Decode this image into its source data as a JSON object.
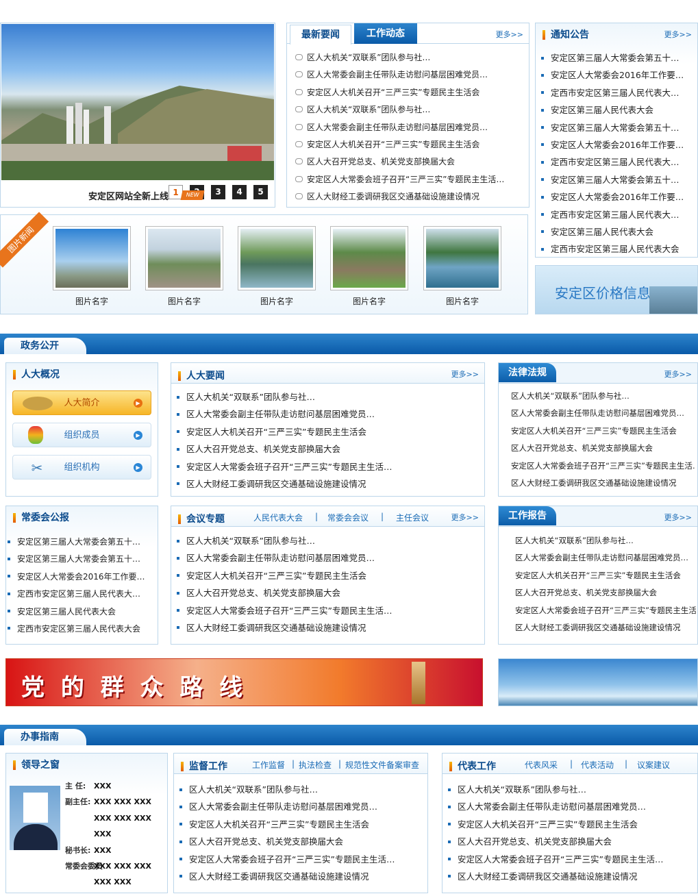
{
  "slider": {
    "caption": "安定区网站全新上线",
    "badge": "NEW",
    "pages": [
      "1",
      "2",
      "3",
      "4",
      "5"
    ]
  },
  "news": {
    "tab1": "最新要闻",
    "tab2": "工作动态",
    "more": "更多>>",
    "items": [
      "区人大机关“双联系”团队参与社…",
      "区人大常委会副主任带队走访慰问基层困难党员…",
      "安定区人大机关召开“三严三实”专题民主生活会",
      "区人大机关“双联系”团队参与社…",
      "区人大常委会副主任带队走访慰问基层困难党员…",
      "安定区人大机关召开“三严三实”专题民主生活会",
      "区人大召开党总支、机关党支部换届大会",
      "安定区人大常委会班子召开“三严三实”专题民主生活…",
      "区人大财经工委调研我区交通基础设施建设情况"
    ]
  },
  "notice": {
    "title": "通知公告",
    "more": "更多>>",
    "items": [
      "安定区第三届人大常委会第五十…",
      "安定区人大常委会2016年工作要…",
      "定西市安定区第三届人民代表大…",
      "安定区第三届人民代表大会",
      "安定区第三届人大常委会第五十…",
      "安定区人大常委会2016年工作要…",
      "定西市安定区第三届人民代表大…",
      "安定区第三届人大常委会第五十…",
      "安定区人大常委会2016年工作要…",
      "定西市安定区第三届人民代表大…",
      "安定区第三届人民代表大会",
      "定西市安定区第三届人民代表大会"
    ]
  },
  "photo": {
    "ribbon": "图片新闻",
    "captions": [
      "图片名字",
      "图片名字",
      "图片名字",
      "图片名字",
      "图片名字"
    ]
  },
  "price_banner": "安定区价格信息网",
  "sec1": {
    "title": "政务公开"
  },
  "overview": {
    "title": "人大概况",
    "buttons": [
      "人大简介",
      "组织成员",
      "组织机构"
    ]
  },
  "bulletin": {
    "title": "常委会公报",
    "items": [
      "安定区第三届人大常委会第五十…",
      "安定区第三届人大常委会第五十…",
      "安定区人大常委会2016年工作要…",
      "定西市安定区第三届人民代表大…",
      "安定区第三届人民代表大会",
      "定西市安定区第三届人民代表大会"
    ]
  },
  "npc_news": {
    "title": "人大要闻",
    "more": "更多>>",
    "items": [
      "区人大机关“双联系”团队参与社…",
      "区人大常委会副主任带队走访慰问基层困难党员…",
      "安定区人大机关召开“三严三实”专题民主生活会",
      "区人大召开党总支、机关党支部换届大会",
      "安定区人大常委会班子召开“三严三实”专题民主生活…",
      "区人大财经工委调研我区交通基础设施建设情况"
    ]
  },
  "meeting": {
    "title": "会议专题",
    "subs": [
      "人民代表大会",
      "常委会会议",
      "主任会议"
    ],
    "more": "更多>>",
    "items": [
      "区人大机关“双联系”团队参与社…",
      "区人大常委会副主任带队走访慰问基层困难党员…",
      "安定区人大机关召开“三严三实”专题民主生活会",
      "区人大召开党总支、机关党支部换届大会",
      "安定区人大常委会班子召开“三严三实”专题民主生活…",
      "区人大财经工委调研我区交通基础设施建设情况"
    ]
  },
  "law": {
    "title": "法律法规",
    "more": "更多>>",
    "items": [
      "区人大机关“双联系”团队参与社…",
      "区人大常委会副主任带队走访慰问基层困难党员…",
      "安定区人大机关召开“三严三实”专题民主生活会",
      "区人大召开党总支、机关党支部换届大会",
      "安定区人大常委会班子召开“三严三实”专题民主生活…",
      "区人大财经工委调研我区交通基础设施建设情况"
    ]
  },
  "report": {
    "title": "工作报告",
    "more": "更多>>",
    "items": [
      "区人大机关“双联系”团队参与社…",
      "区人大常委会副主任带队走访慰问基层困难党员…",
      "安定区人大机关召开“三严三实”专题民主生活会",
      "区人大召开党总支、机关党支部换届大会",
      "安定区人大常委会班子召开“三严三实”专题民主生活…",
      "区人大财经工委调研我区交通基础设施建设情况"
    ]
  },
  "banner_party": "党 的 群 众 路 线",
  "sec2": {
    "title": "办事指南"
  },
  "leader": {
    "title": "领导之窗",
    "rows": [
      {
        "label": "主  任:",
        "names": "XXX"
      },
      {
        "label": "副主任:",
        "names": "XXX XXX XXX"
      },
      {
        "label": "",
        "names": "XXX XXX XXX"
      },
      {
        "label": "",
        "names": "XXX"
      },
      {
        "label": "秘书长:",
        "names": "XXX"
      },
      {
        "label": "常委会委员",
        "names": "XXX XXX XXX"
      },
      {
        "label": "",
        "names": "XXX XXX"
      }
    ]
  },
  "supervise": {
    "title": "监督工作",
    "subs": [
      "工作监督",
      "执法检查",
      "规范性文件备案审查"
    ],
    "items": [
      "区人大机关“双联系”团队参与社…",
      "区人大常委会副主任带队走访慰问基层困难党员…",
      "安定区人大机关召开“三严三实”专题民主生活会",
      "区人大召开党总支、机关党支部换届大会",
      "安定区人大常委会班子召开“三严三实”专题民主生活…",
      "区人大财经工委调研我区交通基础设施建设情况"
    ]
  },
  "deputy": {
    "title": "代表工作",
    "subs": [
      "代表风采",
      "代表活动",
      "议案建议"
    ],
    "items": [
      "区人大机关“双联系”团队参与社…",
      "区人大常委会副主任带队走访慰问基层困难党员…",
      "安定区人大机关召开“三严三实”专题民主生活会",
      "区人大召开党总支、机关党支部换届大会",
      "安定区人大常委会班子召开“三严三实”专题民主生活…",
      "区人大财经工委调研我区交通基础设施建设情况"
    ]
  }
}
